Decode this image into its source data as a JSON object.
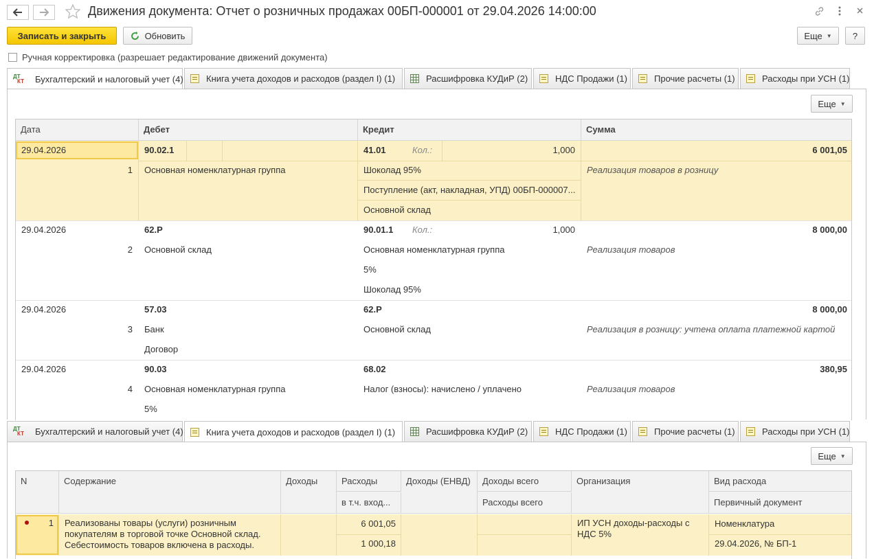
{
  "window": {
    "title": "Движения документа: Отчет о розничных продажах 00БП-000001 от 29.04.2026 14:00:00",
    "icons": [
      "arrow-left-icon",
      "arrow-right-icon",
      "star-icon",
      "link-icon",
      "more-vertical-icon",
      "close-icon"
    ]
  },
  "toolbar": {
    "save_close": "Записать и закрыть",
    "refresh": "Обновить",
    "more": "Еще",
    "help": "?"
  },
  "manual_correction": {
    "label": "Ручная корректировка (разрешает редактирование движений документа)",
    "checked": false
  },
  "tabs": [
    {
      "label": "Бухгалтерский и налоговый учет (4)",
      "icon": "dt-kt-icon"
    },
    {
      "label": "Книга учета доходов и расходов (раздел I) (1)",
      "icon": "book-icon"
    },
    {
      "label": "Расшифровка КУДиР (2)",
      "icon": "grid-icon"
    },
    {
      "label": "НДС Продажи (1)",
      "icon": "book-icon"
    },
    {
      "label": "Прочие расчеты (1)",
      "icon": "book-icon"
    },
    {
      "label": "Расходы при УСН (1)",
      "icon": "book-icon"
    }
  ],
  "top_panel": {
    "active_tab": 0,
    "more": "Еще",
    "columns": {
      "date": "Дата",
      "debit": "Дебет",
      "credit": "Кредит",
      "sum": "Сумма"
    },
    "qty_label": "Кол.:",
    "rows": [
      {
        "date": "29.04.2026",
        "num": "1",
        "debit_account": "90.02.1",
        "debit_lines": [
          "Основная номенклатурная группа"
        ],
        "credit_account": "41.01",
        "qty": "1,000",
        "credit_lines": [
          "Шоколад 95%",
          "Поступление (акт, накладная, УПД) 00БП-000007...",
          "Основной склад"
        ],
        "sum": "6 001,05",
        "description": "Реализация товаров в розницу",
        "selected": true
      },
      {
        "date": "29.04.2026",
        "num": "2",
        "debit_account": "62.Р",
        "debit_lines": [
          "Основной склад"
        ],
        "credit_account": "90.01.1",
        "qty": "1,000",
        "credit_lines": [
          "Основная номенклатурная группа",
          "5%",
          "Шоколад 95%"
        ],
        "sum": "8 000,00",
        "description": "Реализация товаров",
        "selected": false
      },
      {
        "date": "29.04.2026",
        "num": "3",
        "debit_account": "57.03",
        "debit_lines": [
          "Банк",
          "Договор"
        ],
        "credit_account": "62.Р",
        "qty": "",
        "credit_lines": [
          "Основной склад"
        ],
        "sum": "8 000,00",
        "description": "Реализация в розницу: учтена оплата платежной картой",
        "selected": false
      },
      {
        "date": "29.04.2026",
        "num": "4",
        "debit_account": "90.03",
        "debit_lines": [
          "Основная номенклатурная группа",
          "5%"
        ],
        "credit_account": "68.02",
        "qty": "",
        "credit_lines": [
          "Налог (взносы): начислено / уплачено"
        ],
        "sum": "380,95",
        "description": "Реализация товаров",
        "selected": false
      }
    ]
  },
  "bottom_panel": {
    "active_tab": 1,
    "more": "Еще",
    "columns": {
      "n": "N",
      "content": "Содержание",
      "income": "Доходы",
      "expenses": "Расходы",
      "expenses_incl": "в т.ч. вход...",
      "income_envd": "Доходы (ЕНВД)",
      "income_total": "Доходы всего",
      "expenses_total": "Расходы всего",
      "organization": "Организация",
      "expense_type": "Вид расхода",
      "primary_doc": "Первичный документ"
    },
    "rows": [
      {
        "n": "1",
        "content_lines": [
          "Реализованы товары (услуги) розничным",
          "покупателям в торговой точке Основной склад.",
          "Себестоимость товаров включена в расходы."
        ],
        "expenses": "6 001,05",
        "expenses_incl": "1 000,18",
        "organization_lines": [
          "ИП УСН доходы-расходы с",
          "НДС 5%"
        ],
        "expense_type": "Номенклатура",
        "primary_doc": "29.04.2026, № БП-1"
      }
    ]
  }
}
